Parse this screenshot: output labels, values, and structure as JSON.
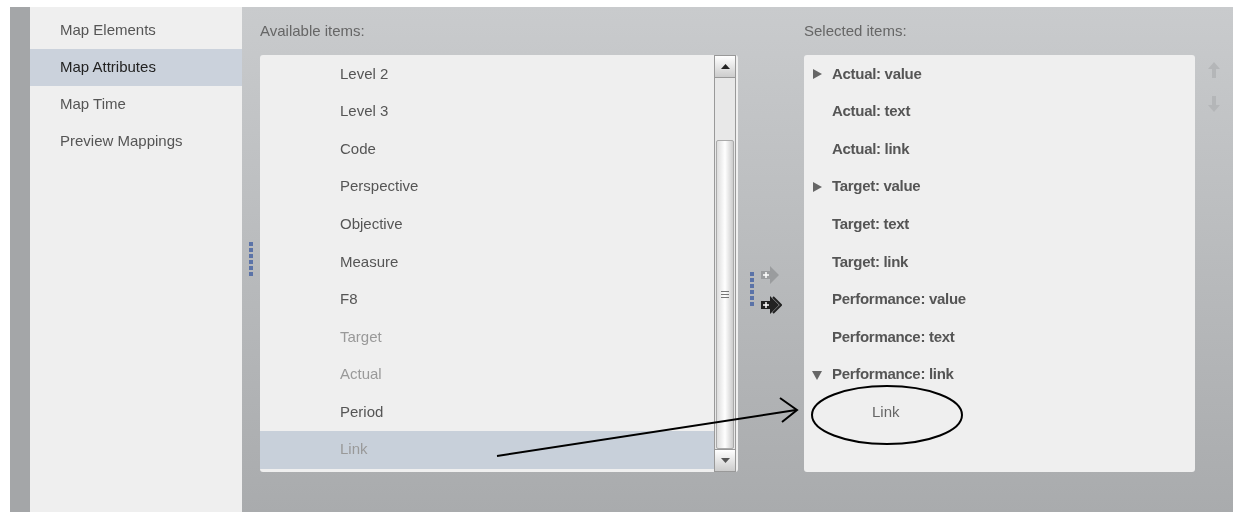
{
  "sidebar": {
    "items": [
      {
        "label": "Map Elements",
        "selected": false
      },
      {
        "label": "Map Attributes",
        "selected": true
      },
      {
        "label": "Map Time",
        "selected": false
      },
      {
        "label": "Preview Mappings",
        "selected": false
      }
    ]
  },
  "available": {
    "title": "Available items:",
    "items": [
      {
        "label": "Level 2",
        "disabled": false,
        "selected": false
      },
      {
        "label": "Level 3",
        "disabled": false,
        "selected": false
      },
      {
        "label": "Code",
        "disabled": false,
        "selected": false
      },
      {
        "label": "Perspective",
        "disabled": false,
        "selected": false
      },
      {
        "label": "Objective",
        "disabled": false,
        "selected": false
      },
      {
        "label": "Measure",
        "disabled": false,
        "selected": false
      },
      {
        "label": "F8",
        "disabled": false,
        "selected": false
      },
      {
        "label": "Target",
        "disabled": true,
        "selected": false
      },
      {
        "label": "Actual",
        "disabled": true,
        "selected": false
      },
      {
        "label": "Period",
        "disabled": false,
        "selected": false
      },
      {
        "label": "Link",
        "disabled": true,
        "selected": true
      }
    ]
  },
  "selected_items": {
    "title": "Selected items:",
    "items": [
      {
        "label": "Actual: value",
        "kind": "group",
        "expanded": false
      },
      {
        "label": "Actual: text",
        "kind": "field"
      },
      {
        "label": "Actual: link",
        "kind": "field"
      },
      {
        "label": "Target: value",
        "kind": "group",
        "expanded": false
      },
      {
        "label": "Target: text",
        "kind": "field"
      },
      {
        "label": "Target: link",
        "kind": "field"
      },
      {
        "label": "Performance: value",
        "kind": "field"
      },
      {
        "label": "Performance: text",
        "kind": "field"
      },
      {
        "label": "Performance: link",
        "kind": "group",
        "expanded": true,
        "children": [
          {
            "label": "Link",
            "kind": "leaf"
          }
        ]
      }
    ]
  }
}
